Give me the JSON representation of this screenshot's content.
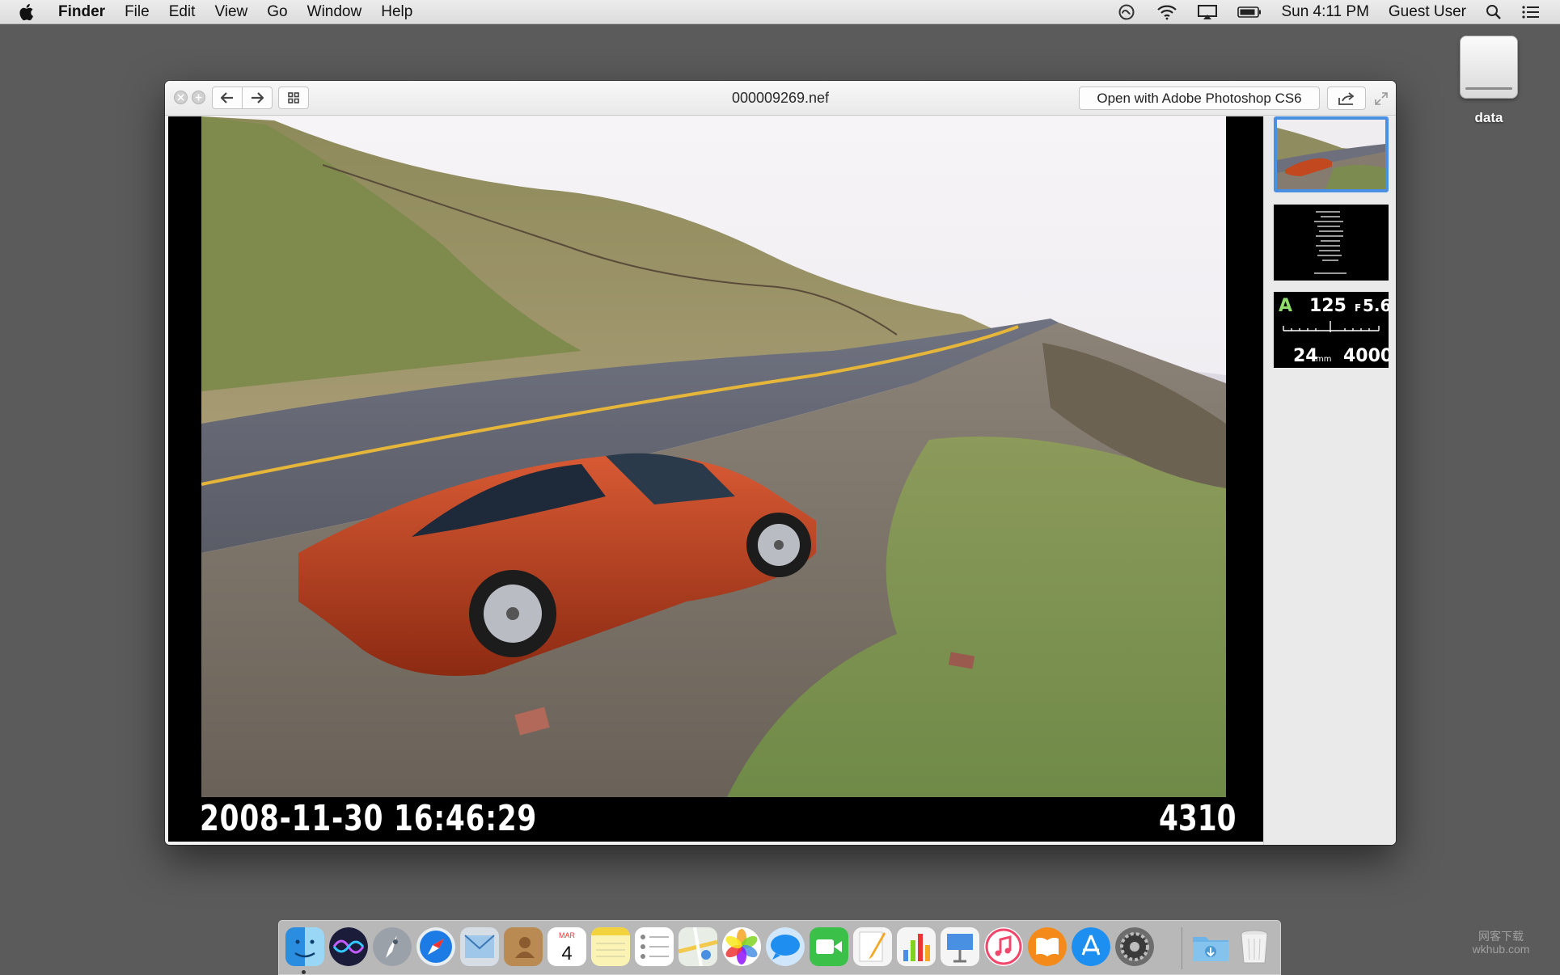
{
  "menubar": {
    "app_name": "Finder",
    "menus": [
      "File",
      "Edit",
      "View",
      "Go",
      "Window",
      "Help"
    ],
    "clock": "Sun 4:11 PM",
    "user": "Guest User"
  },
  "desktop": {
    "drive_label": "data"
  },
  "quicklook": {
    "title": "000009269.nef",
    "open_with_label": "Open with Adobe Photoshop CS6",
    "photo_date": "2008-11-30 16:46:29",
    "photo_number": "4310",
    "exif_thumb": {
      "mode": "A",
      "shutter": "125",
      "aperture_prefix": "F",
      "aperture": "5.6",
      "focal_length": "24",
      "focal_unit": "mm",
      "iso": "4000"
    }
  },
  "dock": {
    "items": [
      "finder-icon",
      "siri-icon",
      "launchpad-icon",
      "safari-icon",
      "mail-icon",
      "contacts-icon",
      "calendar-icon",
      "notes-icon",
      "reminders-icon",
      "maps-icon",
      "photos-icon",
      "messages-icon",
      "facetime-icon",
      "pages-icon",
      "numbers-icon",
      "keynote-icon",
      "itunes-icon",
      "ibooks-icon",
      "app-store-icon",
      "system-preferences-icon",
      "downloads-folder-icon",
      "trash-icon"
    ],
    "calendar_month": "MAR",
    "calendar_day": "4"
  },
  "watermark": {
    "line1": "网客下载",
    "line2": "wkhub.com"
  }
}
